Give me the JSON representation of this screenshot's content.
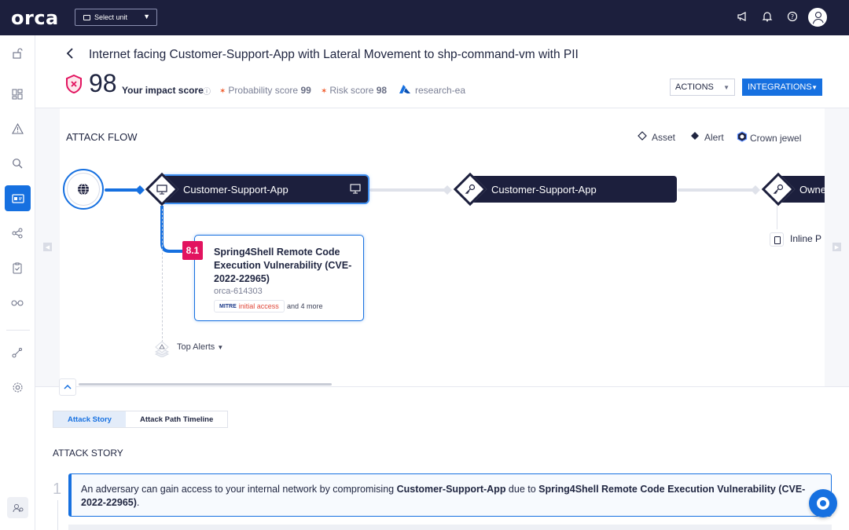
{
  "topbar": {
    "logo": "orca",
    "unit_select": "Select unit",
    "icons": [
      "megaphone-icon",
      "bell-icon",
      "help-icon",
      "avatar"
    ]
  },
  "sidebar": {
    "items": [
      "lock-icon",
      "dashboard-icon",
      "alert-icon",
      "search-icon",
      "attack-path-icon",
      "graph-icon",
      "compliance-icon",
      "glasses-icon",
      "integrations-icon",
      "settings-icon",
      "user-icon"
    ],
    "active": "attack-path-icon"
  },
  "header": {
    "title": "Internet facing Customer-Support-App with Lateral Movement to shp-command-vm with PII",
    "impact_score": "98",
    "impact_label": "Your impact score",
    "probability_label": "Probability score",
    "probability_value": "99",
    "risk_label": "Risk score",
    "risk_value": "98",
    "account": "research-ea",
    "actions_label": "ACTIONS",
    "integrations_label": "INTEGRATIONS"
  },
  "flow": {
    "title": "ATTACK FLOW",
    "legend": {
      "asset": "Asset",
      "alert": "Alert",
      "crown": "Crown jewel"
    },
    "nodes": [
      {
        "label": "Customer-Support-App"
      },
      {
        "label": "Customer-Support-App"
      },
      {
        "label": "Owne"
      }
    ],
    "alert": {
      "score": "8.1",
      "title": "Spring4Shell Remote Code Execution Vulnerability (CVE-2022-22965)",
      "id": "orca-614303",
      "mitre": "MITRE",
      "tactic": "initial access",
      "more": "and 4 more"
    },
    "top_alerts": "Top Alerts",
    "inline_item": "Inline P"
  },
  "tabs": [
    {
      "label": "Attack Story",
      "active": true
    },
    {
      "label": "Attack Path Timeline",
      "active": false
    }
  ],
  "story": {
    "title": "ATTACK STORY",
    "step_num": "1",
    "text_1": "An adversary can gain access to your internal network by compromising ",
    "asset": "Customer-Support-App",
    "text_2": " due to ",
    "vuln": "Spring4Shell Remote Code Execution Vulnerability (CVE-2022-22965)",
    "text_3": "."
  },
  "colors": {
    "navy": "#1c1f3d",
    "accent": "#1670e0",
    "severity": "#e2135f",
    "orange": "#f05a2a"
  }
}
